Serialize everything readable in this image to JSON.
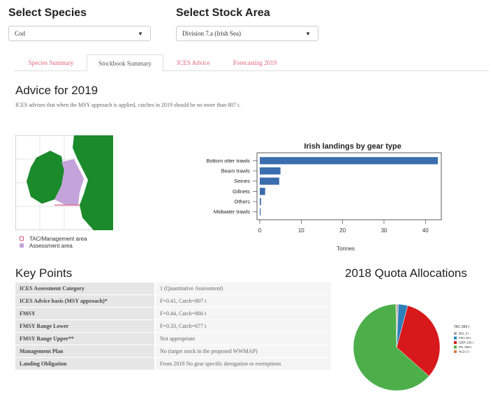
{
  "filters": {
    "species_label": "Select Species",
    "species_value": "Cod",
    "stock_label": "Select Stock Area",
    "stock_value": "Division 7.a (Irish Sea)"
  },
  "tabs": [
    {
      "label": "Species Summary",
      "active": false
    },
    {
      "label": "Stockbook Summary",
      "active": true
    },
    {
      "label": "ICES Advice",
      "active": false
    },
    {
      "label": "Forecasting 2019",
      "active": false
    }
  ],
  "advice": {
    "heading": "Advice for 2019",
    "text": "ICES advises that when the MSY approach is applied, catches in 2019 should be no more than 807 t."
  },
  "map_legend": [
    {
      "label": "TAC/Management area",
      "color": "#e05b83"
    },
    {
      "label": "Assessment area",
      "color": "#c3a3d9"
    }
  ],
  "chart_data": [
    {
      "type": "bar",
      "orientation": "horizontal",
      "title": "Irish landings by gear type",
      "xlabel": "Tonnes",
      "ylabel": "",
      "categories": [
        "Bottom otter trawls",
        "Beam trawls",
        "Seines",
        "Gillnets",
        "Others",
        "Midwater trawls"
      ],
      "values": [
        43,
        5,
        4.7,
        1.3,
        0.3,
        0.2
      ],
      "xlim": [
        0,
        43.5
      ],
      "ticks": [
        0,
        10,
        20,
        30,
        40
      ],
      "color": "#3a6eaf"
    },
    {
      "type": "pie",
      "title": "2018 Quota Allocations",
      "legend_title": "TAC 895 t",
      "categories": [
        "BEL 5 t",
        "FRA 25 t",
        "GBR 235 t",
        "IRL 458 t",
        "NLD 2 t"
      ],
      "values": [
        5,
        25,
        235,
        458,
        2
      ],
      "colors": [
        "#9ba8b6",
        "#2c7fb8",
        "#d7191c",
        "#4daf4a",
        "#e07b39"
      ]
    }
  ],
  "key_points": {
    "heading": "Key Points",
    "rows": [
      {
        "key": "ICES Assessment Category",
        "value": "1 (Quantitative Assessment)"
      },
      {
        "key": "ICES Advice basis (MSY approach)*",
        "value": "F=0.41, Catch=807 t"
      },
      {
        "key": "FMSY",
        "value": "F=0.44, Catch=866 t"
      },
      {
        "key": "FMSY Range Lower",
        "value": "F=0.33, Catch=677 t"
      },
      {
        "key": "FMSY Range Upper**",
        "value": "Not appropriate"
      },
      {
        "key": "Management Plan",
        "value": "No (target stock in the proposed WWMAP)"
      },
      {
        "key": "Landing Obligation",
        "value": "From 2019 No gear specific derogation or exemptions"
      }
    ]
  }
}
